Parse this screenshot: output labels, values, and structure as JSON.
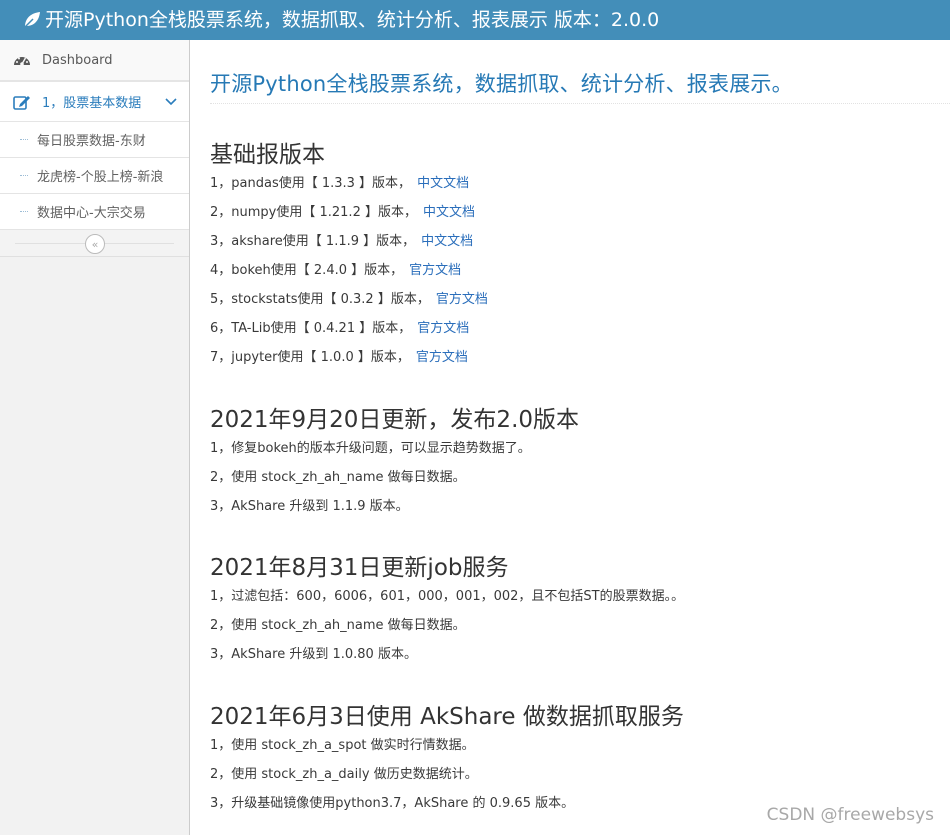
{
  "navbar": {
    "brand": "开源Python全栈股票系统，数据抓取、统计分析、报表展示 版本：2.0.0"
  },
  "sidebar": {
    "dashboard": "Dashboard",
    "menu_open": "1，股票基本数据",
    "submenu": [
      "每日股票数据-东财",
      "龙虎榜-个股上榜-新浪",
      "数据中心-大宗交易"
    ],
    "collapse_glyph": "«"
  },
  "main": {
    "title": "开源Python全栈股票系统，数据抓取、统计分析、报表展示。",
    "sections": [
      {
        "heading": "基础报版本",
        "items": [
          {
            "text": "1，pandas使用【 1.3.3 】版本，",
            "link": "中文文档"
          },
          {
            "text": "2，numpy使用【 1.21.2 】版本，",
            "link": "中文文档"
          },
          {
            "text": "3，akshare使用【 1.1.9 】版本，",
            "link": "中文文档"
          },
          {
            "text": "4，bokeh使用【 2.4.0 】版本，",
            "link": "官方文档"
          },
          {
            "text": "5，stockstats使用【 0.3.2 】版本，",
            "link": "官方文档"
          },
          {
            "text": "6，TA-Lib使用【 0.4.21 】版本，",
            "link": "官方文档"
          },
          {
            "text": "7，jupyter使用【 1.0.0 】版本，",
            "link": "官方文档"
          }
        ]
      },
      {
        "heading": "2021年9月20日更新，发布2.0版本",
        "items": [
          "1，修复bokeh的版本升级问题，可以显示趋势数据了。",
          "2，使用 stock_zh_ah_name 做每日数据。",
          "3，AkShare 升级到 1.1.9 版本。"
        ]
      },
      {
        "heading": "2021年8月31日更新job服务",
        "items": [
          "1，过滤包括：600，6006，601，000，001，002，且不包括ST的股票数据。。",
          "2，使用 stock_zh_ah_name 做每日数据。",
          "3，AkShare 升级到 1.0.80 版本。"
        ]
      },
      {
        "heading": "2021年6月3日使用 AkShare 做数据抓取服务",
        "items": [
          "1，使用 stock_zh_a_spot 做实时行情数据。",
          "2，使用 stock_zh_a_daily 做历史数据统计。",
          "3，升级基础镜像使用python3.7，AkShare 的 0.9.65 版本。"
        ]
      }
    ]
  },
  "watermark": "CSDN @freewebsys",
  "colors": {
    "navbar": "#438eb9",
    "link": "#2a6ebb",
    "title": "#2679b5"
  }
}
